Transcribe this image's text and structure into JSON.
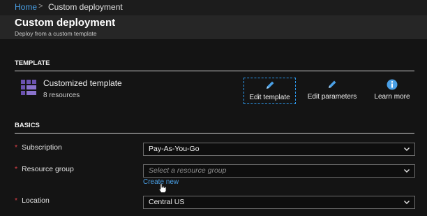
{
  "breadcrumb": {
    "home": "Home",
    "separator": ">",
    "current": "Custom deployment"
  },
  "header": {
    "title": "Custom deployment",
    "subtitle": "Deploy from a custom template"
  },
  "template": {
    "section_label": "TEMPLATE",
    "name": "Customized template",
    "resource_count": "8 resources",
    "icon": "template-grid-icon",
    "actions": [
      {
        "label": "Edit template",
        "icon": "pencil-icon"
      },
      {
        "label": "Edit parameters",
        "icon": "pencil-icon"
      },
      {
        "label": "Learn more",
        "icon": "info-icon"
      }
    ]
  },
  "basics": {
    "section_label": "BASICS",
    "required_marker": "*",
    "subscription": {
      "label": "Subscription",
      "value": "Pay-As-You-Go"
    },
    "resource_group": {
      "label": "Resource group",
      "placeholder": "Select a resource group",
      "create_new": "Create new"
    },
    "location": {
      "label": "Location",
      "value": "Central US"
    }
  },
  "colors": {
    "accent": "#4aa0e6",
    "required": "#e0414a",
    "icon_purple": "#6b52b0"
  }
}
